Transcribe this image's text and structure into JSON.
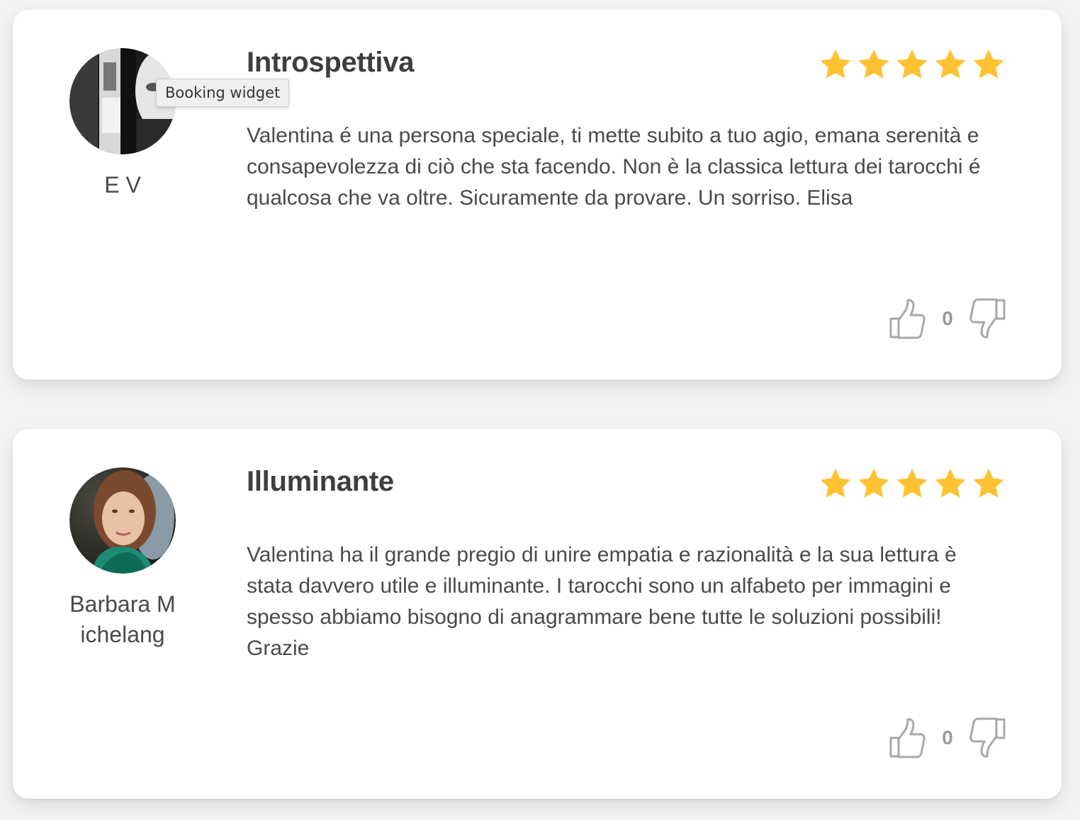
{
  "tooltip": {
    "text": "Booking widget"
  },
  "reviews": [
    {
      "author": "E V",
      "title": "Introspettiva",
      "rating": 5,
      "max_rating": 5,
      "body": "Valentina é una persona speciale, ti mette subito a tuo agio, emana serenità e consapevolezza di ciò che sta facendo. Non è la classica lettura dei tarocchi é qualcosa che va oltre. Sicuramente da provare. Un sorriso. Elisa",
      "votes": "0"
    },
    {
      "author": "Barbara Michelang",
      "title": "Illuminante",
      "rating": 5,
      "max_rating": 5,
      "body": "Valentina ha il grande pregio di unire empatia e razionalità e la sua lettura è stata davvero utile e illuminante. I tarocchi sono un alfabeto per immagini e spesso abbiamo bisogno di anagrammare bene tutte le soluzioni possibili! Grazie",
      "votes": "0"
    }
  ],
  "colors": {
    "star": "#FFC233",
    "card_bg": "#FFFFFF",
    "page_bg": "#F3F3F3",
    "text": "#4A4A4A",
    "vote_icon": "#A8A8A8"
  },
  "icons": {
    "rating": "star-icon",
    "upvote": "thumbs-up-icon",
    "downvote": "thumbs-down-icon"
  }
}
